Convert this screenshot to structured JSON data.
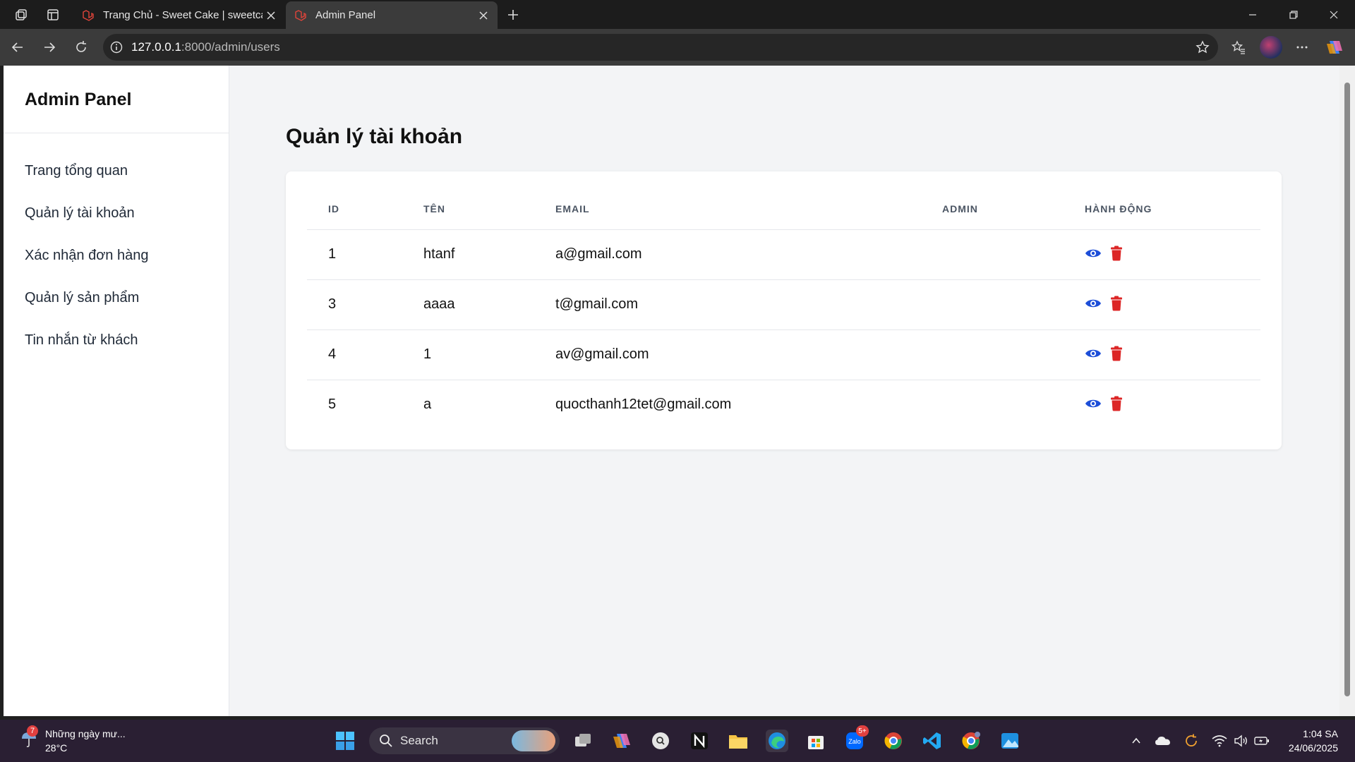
{
  "browser": {
    "tabs": [
      {
        "title": "Trang Chủ - Sweet Cake | sweetca",
        "active": false
      },
      {
        "title": "Admin Panel",
        "active": true
      }
    ],
    "url_host": "127.0.0.1",
    "url_path": ":8000/admin/users"
  },
  "sidebar": {
    "title": "Admin Panel",
    "items": [
      {
        "label": "Trang tổng quan"
      },
      {
        "label": "Quản lý tài khoản"
      },
      {
        "label": "Xác nhận đơn hàng"
      },
      {
        "label": "Quản lý sản phẩm"
      },
      {
        "label": "Tin nhắn từ khách"
      }
    ]
  },
  "main": {
    "title": "Quản lý tài khoản",
    "table": {
      "headers": [
        "ID",
        "TÊN",
        "EMAIL",
        "ADMIN",
        "HÀNH ĐỘNG"
      ],
      "rows": [
        {
          "id": "1",
          "name": "htanf",
          "email": "a@gmail.com",
          "admin": ""
        },
        {
          "id": "3",
          "name": "aaaa",
          "email": "t@gmail.com",
          "admin": ""
        },
        {
          "id": "4",
          "name": "1",
          "email": "av@gmail.com",
          "admin": ""
        },
        {
          "id": "5",
          "name": "a",
          "email": "quocthanh12tet@gmail.com",
          "admin": ""
        }
      ],
      "actions": [
        "eye-icon",
        "trash-icon"
      ]
    }
  },
  "colors": {
    "view_icon": "#1d4ed8",
    "delete_icon": "#dc2626",
    "page_bg": "#f3f4f6"
  },
  "taskbar": {
    "weather_text": "Những ngày mư...",
    "temperature": "28°C",
    "weather_badge": "7",
    "search_label": "Search",
    "zalo_badge": "5+",
    "time": "1:04 SA",
    "date": "24/06/2025"
  }
}
